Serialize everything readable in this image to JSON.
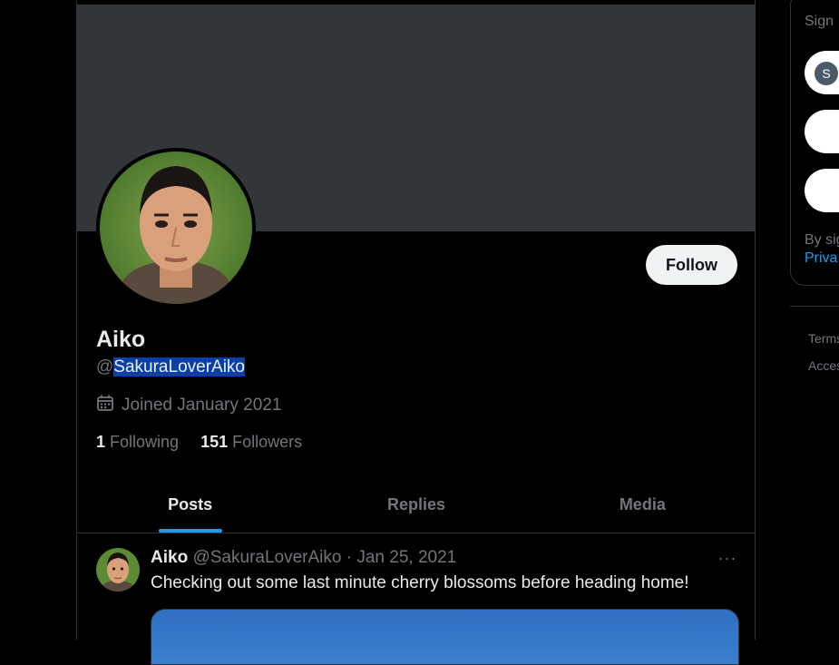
{
  "profile": {
    "display_name": "Aiko",
    "handle_prefix": "@",
    "handle": "SakuraLoverAiko",
    "joined": "Joined January 2021",
    "following_count": "1",
    "following_label": "Following",
    "followers_count": "151",
    "followers_label": "Followers",
    "follow_button": "Follow"
  },
  "tabs": [
    {
      "label": "Posts",
      "active": true
    },
    {
      "label": "Replies",
      "active": false
    },
    {
      "label": "Media",
      "active": false
    }
  ],
  "tweet": {
    "name": "Aiko",
    "handle": "@SakuraLoverAiko",
    "separator": "·",
    "date": "Jan 25, 2021",
    "text": "Checking out some last minute cherry blossoms before heading home!",
    "more": "···"
  },
  "sidebar": {
    "sign_text": "Sign",
    "s_initial": "S",
    "by_text": "By sig",
    "privacy_text": "Priva",
    "links": [
      "Terms",
      "Acces"
    ]
  },
  "colors": {
    "accent": "#1d9bf0",
    "banner": "#333639",
    "selection": "#0b3fa8"
  }
}
